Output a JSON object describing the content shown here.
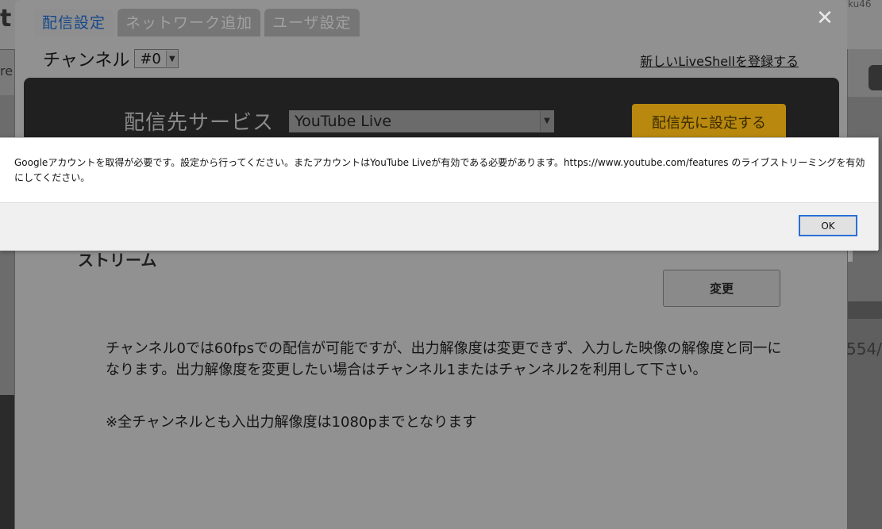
{
  "background": {
    "left_letter": "t",
    "left_fragment": "re",
    "right_top_fragment": "ku46",
    "right_text": "554/"
  },
  "modal": {
    "tabs": [
      {
        "label": "配信設定",
        "active": true
      },
      {
        "label": "ネットワーク追加",
        "active": false
      },
      {
        "label": "ユーザ設定",
        "active": false
      }
    ],
    "close_glyph": "✕",
    "channel": {
      "label": "チャンネル",
      "selected": "#0"
    },
    "register_link": "新しいLiveShellを登録する",
    "service": {
      "label": "配信先サービス",
      "selected": "YouTube Live",
      "set_button": "配信先に設定する"
    },
    "stream": {
      "heading": "ストリーム",
      "change_button": "変更"
    },
    "info_text": "チャンネル0では60fpsでの配信が可能ですが、出力解像度は変更できず、入力した映像の解像度と同一になります。出力解像度を変更したい場合はチャンネル1またはチャンネル2を利用して下さい。",
    "note_text": "※全チャンネルとも入出力解像度は1080pまでとなります"
  },
  "alert": {
    "message": "Googleアカウントを取得が必要です。設定から行ってください。またアカウントはYouTube Liveが有効である必要があります。https://www.youtube.com/features のライブストリーミングを有効にしてください。",
    "ok_button": "OK"
  },
  "colors": {
    "active_tab_text": "#16488a",
    "set_button": "#b8890e",
    "ok_border": "#2a6fd6"
  }
}
